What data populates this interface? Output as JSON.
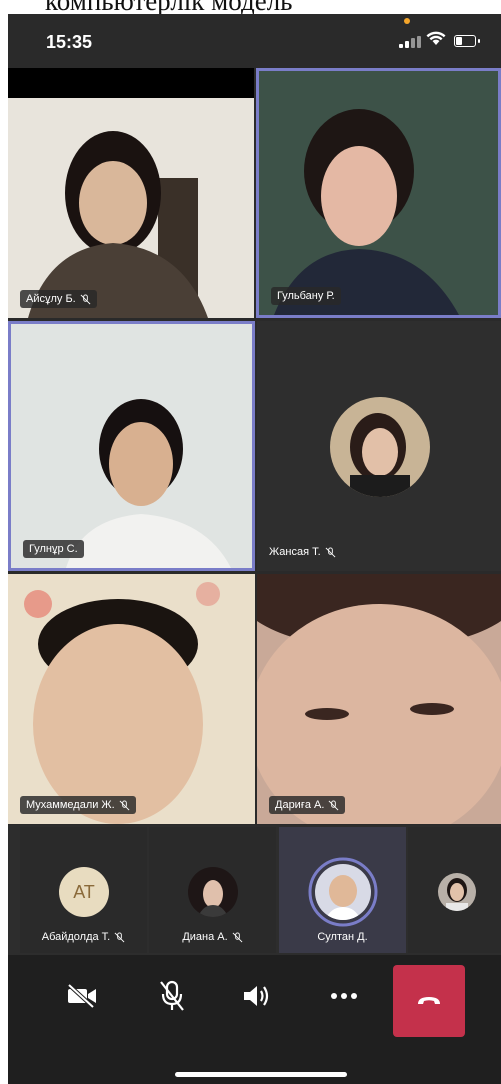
{
  "doc_header": {
    "text": "компьютерлік модель"
  },
  "status_bar": {
    "time": "15:35"
  },
  "tiles": [
    {
      "name": "Айсұлу Б.",
      "muted": true
    },
    {
      "name": "Гульбану Р.",
      "muted": false
    },
    {
      "name": "Гулнұр С.",
      "muted": false
    },
    {
      "name": "Жансая Т.",
      "muted": true
    },
    {
      "name": "Мухаммедали Ж.",
      "muted": true
    },
    {
      "name": "Дариға А.",
      "muted": true
    }
  ],
  "strip": [
    {
      "name": "Абайдолда Т.",
      "initials": "АТ",
      "muted": true
    },
    {
      "name": "Диана А.",
      "muted": true
    },
    {
      "name": "Султан Д.",
      "muted": false
    },
    {
      "name": "",
      "muted": false
    }
  ],
  "controls": [
    "camera-off-icon",
    "mic-off-icon",
    "speaker-icon",
    "more-icon",
    "hang-up-icon"
  ],
  "colors": {
    "active_border": "#7a7dc8",
    "hangup": "#c4314b",
    "background": "#2a2a2a"
  }
}
